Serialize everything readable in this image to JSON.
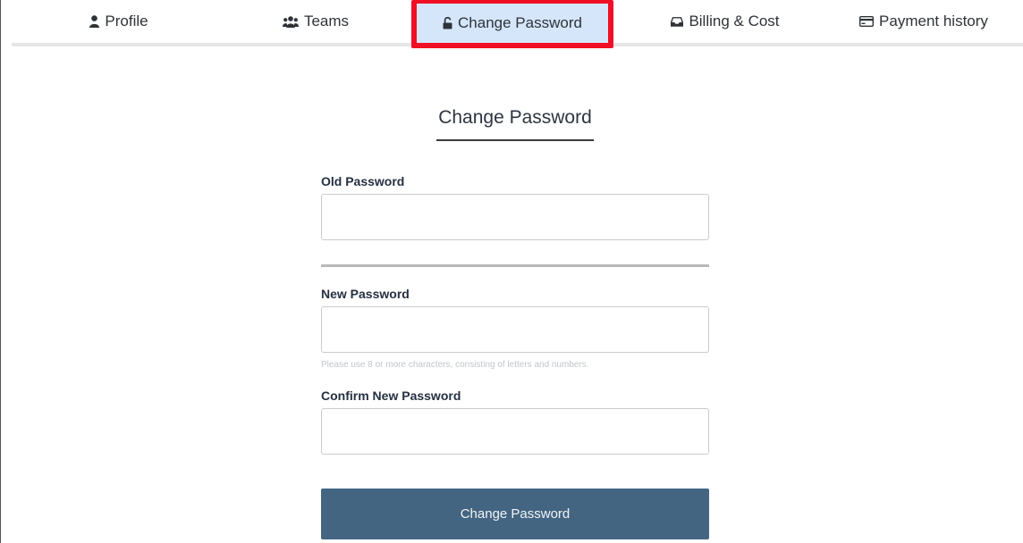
{
  "tabs": {
    "profile": {
      "label": "Profile",
      "icon": "user-icon"
    },
    "teams": {
      "label": "Teams",
      "icon": "users-icon"
    },
    "change_password": {
      "label": "Change Password",
      "icon": "unlock-icon",
      "active": true
    },
    "billing": {
      "label": "Billing & Cost",
      "icon": "inbox-icon"
    },
    "payment_history": {
      "label": "Payment history",
      "icon": "credit-card-icon"
    }
  },
  "form": {
    "title": "Change Password",
    "old_password": {
      "label": "Old Password",
      "value": "",
      "placeholder": ""
    },
    "new_password": {
      "label": "New Password",
      "value": "",
      "placeholder": "",
      "hint": "Please use 8 or more characters, consisting of letters and numbers."
    },
    "confirm_password": {
      "label": "Confirm New Password",
      "value": "",
      "placeholder": ""
    },
    "submit_label": "Change Password"
  },
  "colors": {
    "active_tab_bg": "#d5e6fb",
    "highlight_border": "#f00f24",
    "submit_bg": "#436582"
  }
}
